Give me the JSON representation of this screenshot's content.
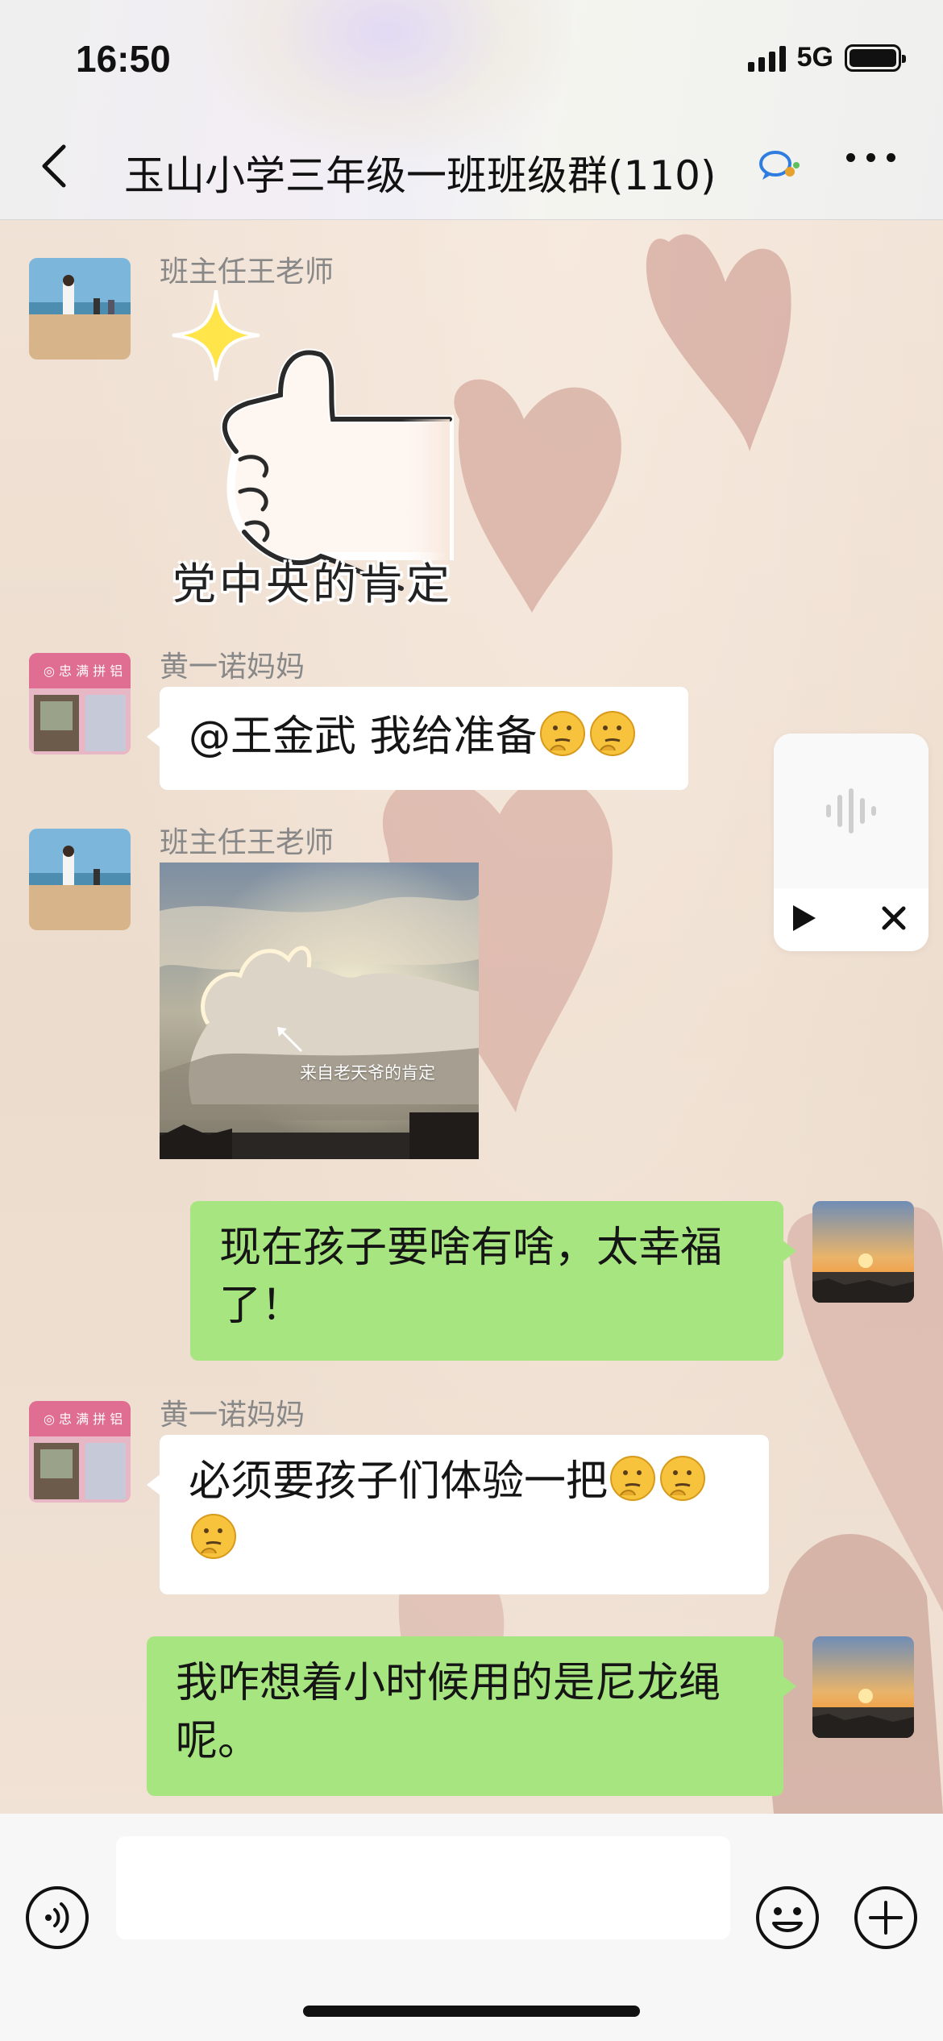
{
  "status_bar": {
    "time": "16:50",
    "network": "5G",
    "icons": [
      "signal-icon",
      "battery-icon"
    ]
  },
  "nav": {
    "title": "玉山小学三年级一班班级群(110)",
    "icons": [
      "back-icon",
      "group-chat-icon",
      "more-icon"
    ]
  },
  "messages": [
    {
      "direction": "incoming",
      "sender": "班主任王老师",
      "type": "sticker",
      "sticker_text": "党中央的肯定"
    },
    {
      "direction": "incoming",
      "sender": "黄一诺妈妈",
      "type": "text",
      "text": "@王金武 我给准备",
      "emoji_count": 2
    },
    {
      "direction": "incoming",
      "sender": "班主任王老师",
      "type": "image",
      "image_caption": "来自老天爷的肯定"
    },
    {
      "direction": "outgoing",
      "type": "text",
      "text": "现在孩子要啥有啥，太幸福了！"
    },
    {
      "direction": "incoming",
      "sender": "黄一诺妈妈",
      "type": "text",
      "text": "必须要孩子们体验一把",
      "emoji_count": 3
    },
    {
      "direction": "outgoing",
      "type": "text",
      "text": "我咋想着小时候用的是尼龙绳呢。"
    }
  ],
  "float_panel": {
    "icons": [
      "voice-wave-icon",
      "play-icon",
      "close-icon"
    ]
  },
  "input_bar": {
    "value": "",
    "icons": [
      "voice-mode-icon",
      "emoji-icon",
      "plus-icon"
    ]
  },
  "colors": {
    "outgoing_bubble": "#a6e57f",
    "incoming_bubble": "#ffffff",
    "sender_name": "#888888"
  }
}
